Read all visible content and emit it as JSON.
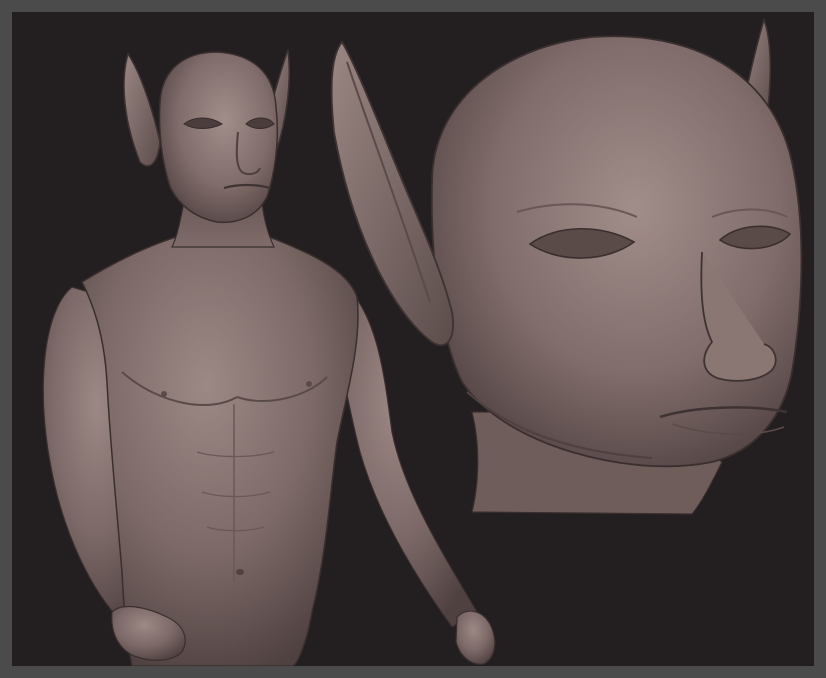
{
  "scene": {
    "frame_color": "#4b4b4b",
    "background_color": "#231f20",
    "clay_base": "#7d6a68",
    "clay_light": "#a18d8a",
    "clay_shadow": "#4f4140",
    "clay_dark": "#3a2f2e"
  },
  "subjects": {
    "left": "elf-figure-full-torso-sculpt",
    "right": "elf-head-closeup-sculpt"
  }
}
